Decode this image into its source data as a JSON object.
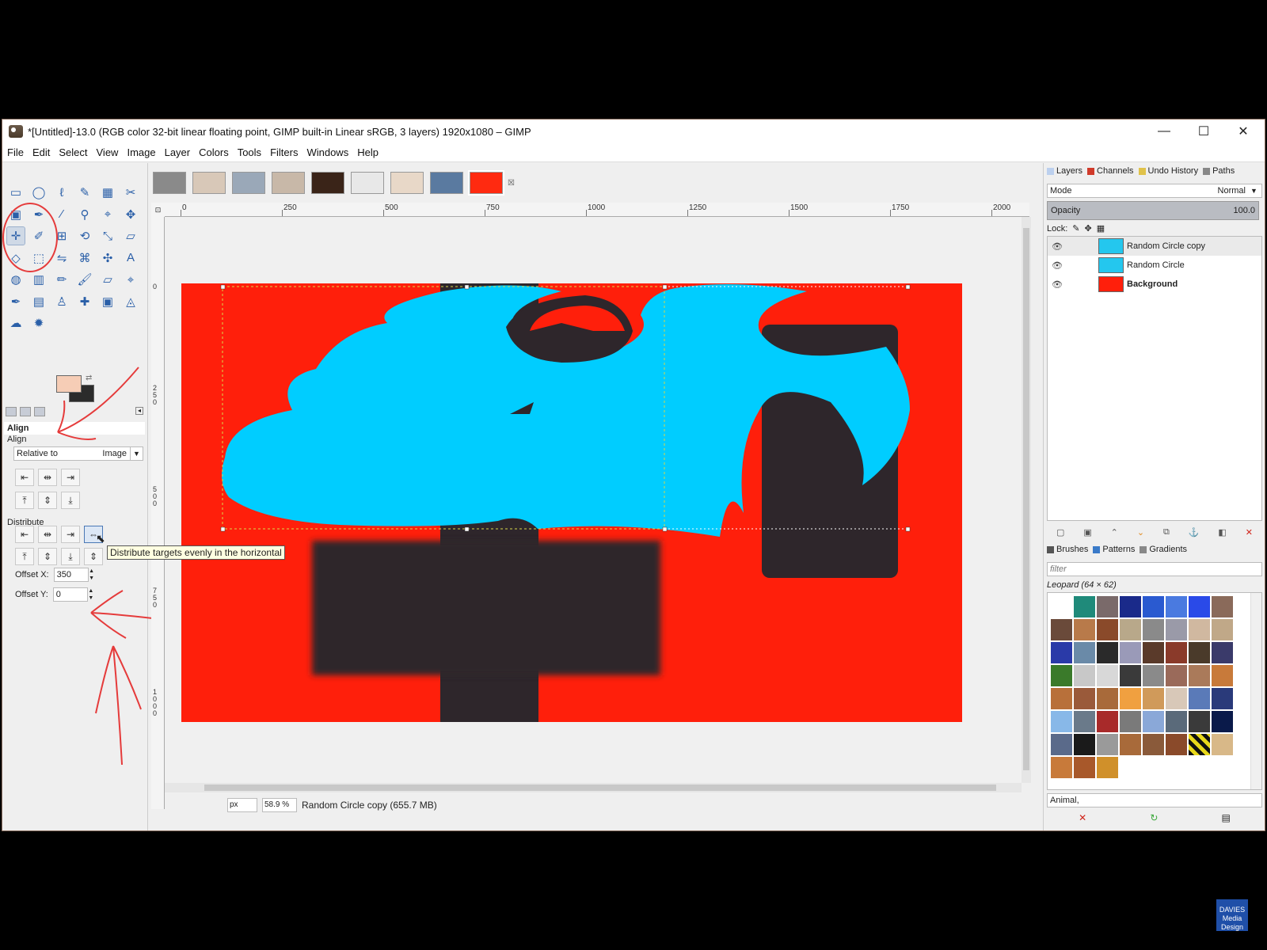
{
  "window": {
    "title": "*[Untitled]-13.0 (RGB color 32-bit linear floating point, GIMP built-in Linear sRGB, 3 layers) 1920x1080 – GIMP",
    "minimize": "—",
    "maximize": "☐",
    "close": "✕"
  },
  "menu": [
    "File",
    "Edit",
    "Select",
    "View",
    "Image",
    "Layer",
    "Colors",
    "Tools",
    "Filters",
    "Windows",
    "Help"
  ],
  "toolbox": {
    "tools": [
      "rect-select",
      "ellipse-select",
      "free-select",
      "fuzzy-select",
      "select-by-color",
      "scissors-select",
      "foreground-select",
      "paths",
      "color-picker",
      "zoom",
      "measure",
      "move",
      "align",
      "crop",
      "unified-transform",
      "rotate",
      "scale",
      "shear",
      "perspective",
      "3d-transform",
      "flip",
      "cage-transform",
      "handle-transform",
      "text",
      "bucket-fill",
      "gradient",
      "pencil",
      "paintbrush",
      "eraser",
      "airbrush",
      "ink",
      "mypaint-brush",
      "clone",
      "heal",
      "perspective-clone",
      "blur",
      "smudge",
      "dodge-burn"
    ],
    "tool_glyphs": [
      "▭",
      "◯",
      "ℓ",
      "✎",
      "▦",
      "✂",
      "▣",
      "✒",
      "⁄",
      "⚲",
      "⌖",
      "✥",
      "✛",
      "✐",
      "⊞",
      "⟲",
      "⤡",
      "▱",
      "◇",
      "⬚",
      "⇋",
      "⌘",
      "✣",
      "A",
      "◍",
      "▥",
      "✏",
      "🖌",
      "▱",
      "⌖",
      "✒",
      "▤",
      "♙",
      "✚",
      "▣",
      "◬",
      "☁",
      "✹"
    ],
    "active_tool_index": 12,
    "fg_color": "#f6cdb6",
    "bg_color": "#2b2b2b"
  },
  "tool_options": {
    "header": "Align",
    "align_label": "Align",
    "relative_to_label": "Relative to",
    "relative_to_value": "Image",
    "distribute_label": "Distribute",
    "offset_x_label": "Offset X:",
    "offset_x_value": "350",
    "offset_y_label": "Offset Y:",
    "offset_y_value": "0",
    "tooltip": "Distribute targets evenly in the horizontal",
    "align_row1": [
      "⇤",
      "⇹",
      "⇥"
    ],
    "align_row2": [
      "⤒",
      "⇕",
      "⤓"
    ],
    "distribute_row1": [
      "⇤",
      "⇹",
      "⇥",
      "⇔"
    ],
    "distribute_row2": [
      "⤒",
      "⇕",
      "⤓",
      "⇕"
    ]
  },
  "image_tabs": {
    "thumbnails": [
      "#8a8a8a",
      "#d8c8b8",
      "#9aa8b8",
      "#c8b8a8",
      "#3a2418",
      "#e8e8e8",
      "#e8d8c8",
      "#5a7aa0",
      "#ff2a10"
    ],
    "active_index": 8,
    "close_glyph": "☒"
  },
  "rulers": {
    "h_labels": [
      "0",
      "250",
      "500",
      "750",
      "1000",
      "1250",
      "1500",
      "1750",
      "2000"
    ],
    "v_labels": [
      "0",
      "250",
      "500",
      "750",
      "1000"
    ]
  },
  "status": {
    "unit": "px",
    "zoom": "58.9 %",
    "message": "Random Circle copy (655.7 MB)"
  },
  "layers_dock": {
    "tabs": [
      "Layers",
      "Channels",
      "Undo History",
      "Paths"
    ],
    "mode_label": "Mode",
    "mode_value": "Normal",
    "opacity_label": "Opacity",
    "opacity_value": "100.0",
    "lock_label": "Lock:",
    "layers": [
      {
        "name": "Random Circle copy",
        "bold": false,
        "thumb": "#24c7ee"
      },
      {
        "name": "Random Circle",
        "bold": false,
        "thumb": "#24c7ee"
      },
      {
        "name": "Background",
        "bold": true,
        "thumb": "#ff1f0b"
      }
    ]
  },
  "patterns_dock": {
    "tabs": [
      "Brushes",
      "Patterns",
      "Gradients"
    ],
    "filter_placeholder": "filter",
    "selected_name": "Leopard (64 × 62)",
    "tags_value": "Animal,",
    "swatches": [
      "#ffffff",
      "#1f8a7a",
      "#7a6a6a",
      "#1a2a8a",
      "#2a5ad0",
      "#4a7ae0",
      "#2a4ae8",
      "#8a6a5a",
      "#6a4a3a",
      "#b87a4a",
      "#8a4a2a",
      "#b8a88a",
      "#8a8a8a",
      "#9a9aa8",
      "#d0b8a0",
      "#c0a888",
      "#2a3aa8",
      "#6a8aa8",
      "#2a2a2a",
      "#9a9ab8",
      "#5a3a2a",
      "#8a3a2a",
      "#4a3a2a",
      "#3a3a6a",
      "#3a7a2a",
      "#c8c8c8",
      "#d8d8d8",
      "#3a3a3a",
      "#8a8a8a",
      "#9a6a5a",
      "#aa7a5a",
      "#c87a3a",
      "#b8703a",
      "#9a5a3a",
      "#a86a3a",
      "#f0a040",
      "#d09a5a",
      "#d8c8b8",
      "#5a7ab8",
      "#2a3a7a",
      "#88b8e8",
      "#6a7a8a",
      "#a82a2a",
      "#7a7a7a",
      "#8aa8d8",
      "#5a6a7a",
      "#3a3a3a",
      "#0a1a4a",
      "#5a6a8a",
      "#1a1a1a",
      "#9a9a9a",
      "#a86a3a",
      "#8a5a3a",
      "#8a4a2a",
      "#e8d81a",
      "#d8b888",
      "#c87a3a",
      "#a8582a",
      "#d0902a"
    ]
  },
  "watermark": "DAVIES Media Design"
}
